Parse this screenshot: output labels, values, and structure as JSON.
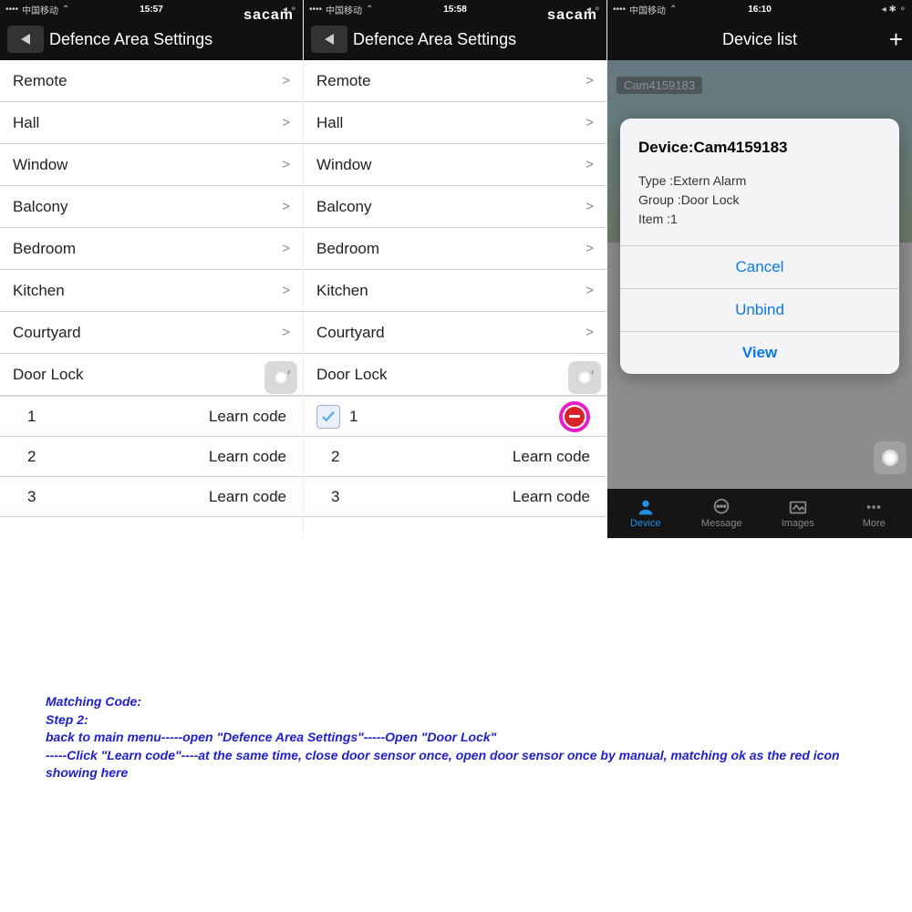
{
  "brand": "sacam",
  "status": {
    "carrier": "中国移动",
    "time1": "15:57",
    "time2": "15:58",
    "time3": "16:10"
  },
  "nav": {
    "defence_title": "Defence Area Settings",
    "device_list_title": "Device list"
  },
  "areas": [
    {
      "label": "Remote",
      "open": false
    },
    {
      "label": "Hall",
      "open": false
    },
    {
      "label": "Window",
      "open": false
    },
    {
      "label": "Balcony",
      "open": false
    },
    {
      "label": "Bedroom",
      "open": false
    },
    {
      "label": "Kitchen",
      "open": false
    },
    {
      "label": "Courtyard",
      "open": false
    },
    {
      "label": "Door Lock",
      "open": true
    }
  ],
  "learn_label": "Learn code",
  "sub1": [
    {
      "num": "1"
    },
    {
      "num": "2"
    },
    {
      "num": "3"
    }
  ],
  "sub2": [
    {
      "num": "1",
      "checked": true
    },
    {
      "num": "2"
    },
    {
      "num": "3"
    }
  ],
  "cam_label": "Cam4159183",
  "alert": {
    "title": "Device:Cam4159183",
    "type_line": "Type :Extern Alarm",
    "group_line": "Group :Door Lock",
    "item_line": "Item :1",
    "cancel": "Cancel",
    "unbind": "Unbind",
    "view": "View"
  },
  "tabs": {
    "device": "Device",
    "message": "Message",
    "images": "Images",
    "more": "More"
  },
  "instructions": {
    "heading": "Matching Code:",
    "step": "Step 2:",
    "line1": "back to main menu-----open \"Defence Area Settings\"-----Open \"Door Lock\"",
    "line2": "-----Click \"Learn code\"----at the same time, close door sensor once, open door sensor once by manual, matching ok as the red icon showing here"
  }
}
